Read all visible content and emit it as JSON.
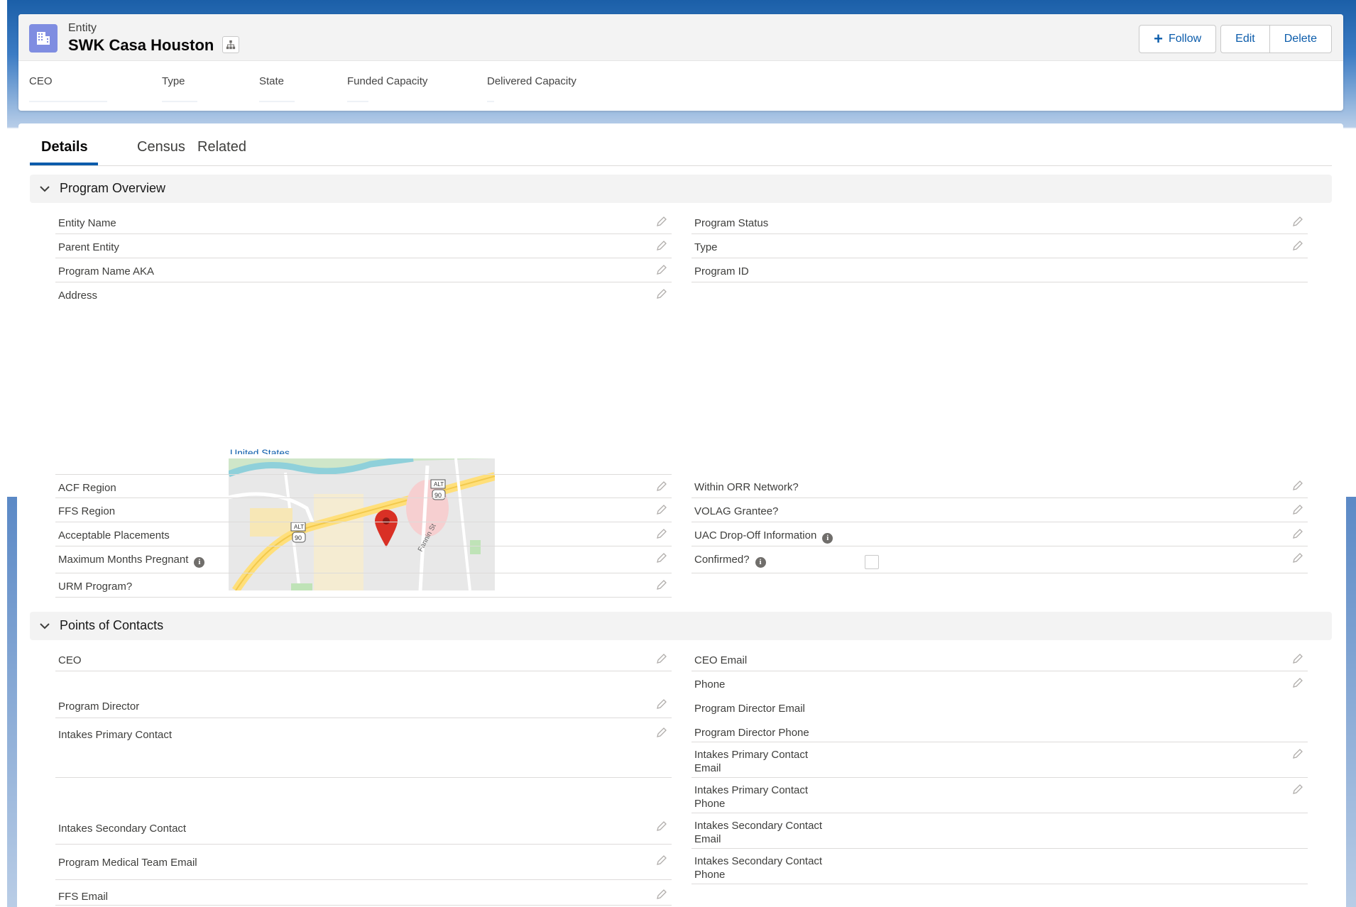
{
  "header": {
    "object_type": "Entity",
    "record_title": "SWK Casa Houston",
    "actions": {
      "follow": "Follow",
      "edit": "Edit",
      "delete": "Delete"
    },
    "highlights": [
      "CEO",
      "Type",
      "State",
      "Funded Capacity",
      "Delivered Capacity"
    ]
  },
  "tabs": [
    "Details",
    "Census",
    "Related"
  ],
  "active_tab": "Details",
  "sections": {
    "program_overview": {
      "title": "Program Overview",
      "left_fields": [
        "Entity Name",
        "Parent Entity",
        "Program Name AKA",
        "Address"
      ],
      "right_fields": [
        "Program Status",
        "Type",
        "Program ID"
      ],
      "map_label": "United States",
      "lower_left_fields": [
        "ACF Region",
        "FFS Region",
        "Acceptable Placements",
        "Maximum Months Pregnant",
        "URM Program?"
      ],
      "lower_right_fields": [
        "Within ORR Network?",
        "VOLAG Grantee?",
        "UAC Drop-Off Information",
        "Confirmed?"
      ],
      "confirmed_checked": false
    },
    "points_of_contacts": {
      "title": "Points of Contacts",
      "left_fields": [
        "CEO",
        "Program Director",
        "Intakes Primary Contact",
        "Intakes Secondary Contact",
        "Program Medical Team Email",
        "FFS Email"
      ],
      "right_fields": [
        "CEO Email",
        "Phone",
        "Program Director Email",
        "Program Director Phone",
        "Intakes Primary Contact Email",
        "Intakes Primary Contact Phone",
        "Intakes Secondary Contact Email",
        "Intakes Secondary Contact Phone"
      ]
    }
  },
  "map": {
    "road_labels": [
      "ALT",
      "90",
      "ALT",
      "90",
      "Fannin St"
    ]
  },
  "colors": {
    "brand": "#0b5cab",
    "entity_icon": "#7f8de1",
    "section_bg": "#f3f3f3",
    "map_pin": "#d93025"
  }
}
